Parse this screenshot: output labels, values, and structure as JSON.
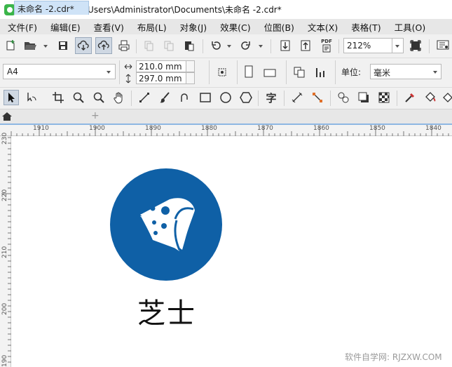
{
  "window": {
    "title": "CorelDRAW - C:\\Users\\Administrator\\Documents\\未命名 -2.cdr*"
  },
  "menu": [
    {
      "label": "文件(F)"
    },
    {
      "label": "编辑(E)"
    },
    {
      "label": "查看(V)"
    },
    {
      "label": "布局(L)"
    },
    {
      "label": "对象(J)"
    },
    {
      "label": "效果(C)"
    },
    {
      "label": "位图(B)"
    },
    {
      "label": "文本(X)"
    },
    {
      "label": "表格(T)"
    },
    {
      "label": "工具(O)"
    }
  ],
  "standard_toolbar": {
    "zoom_value": "212%",
    "pdf_label": "PDF"
  },
  "property_bar": {
    "page_size": "A4",
    "width": "210.0 mm",
    "height": "297.0 mm",
    "units_label": "单位:",
    "units_value": "毫米"
  },
  "toolbox": {
    "text_tool_label": "字"
  },
  "tabs": {
    "document_tab": "未命名 -2.cdr*",
    "add_tab": "+"
  },
  "ruler": {
    "horizontal_ticks": [
      "1910",
      "1900",
      "1890",
      "1880",
      "1870",
      "1860",
      "1850",
      "1840"
    ],
    "vertical_ticks": [
      "230",
      "220",
      "210",
      "200",
      "190"
    ]
  },
  "canvas": {
    "logo_text": "芝士",
    "logo_circle_color": "#0f60a6"
  },
  "watermark": "软件自学网: RJZXW.COM"
}
